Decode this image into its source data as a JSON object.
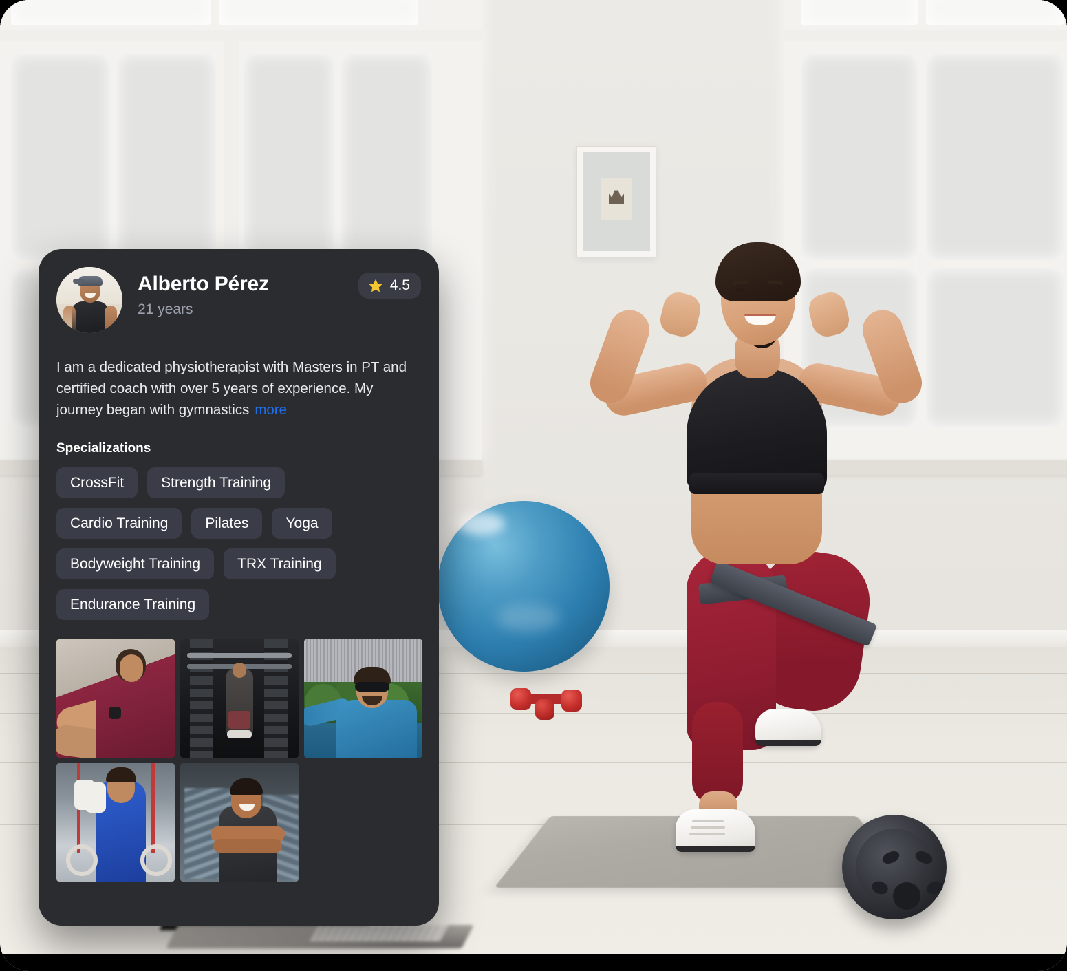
{
  "profile": {
    "name": "Alberto Pérez",
    "age": "21 years",
    "rating": "4.5",
    "rating_icon": "star-icon",
    "avatar_alt": "profile-photo",
    "bio": "I am a dedicated physiotherapist with Masters in PT and certified coach with over 5 years of experience. My journey began with gymnastics",
    "more_label": "more"
  },
  "specializations": {
    "title": "Specializations",
    "tags": [
      "CrossFit",
      "Strength Training",
      "Cardio Training",
      "Pilates",
      "Yoga",
      "Bodyweight Training",
      "TRX Training",
      "Endurance Training"
    ]
  },
  "gallery": {
    "items": [
      "physiotherapy-session-photo",
      "gym-squat-rack-photo",
      "city-viewpoint-selfie-photo",
      "gymnastics-rings-photo",
      "trainer-portrait-gym-photo"
    ]
  },
  "background": {
    "scene": "bright-gym-studio-with-windows",
    "subject": "woman-performing-lunge-with-resistance-band",
    "props": [
      "exercise-ball",
      "red-dumbbells",
      "yoga-mat",
      "ab-roller-wheel",
      "framed-wall-art",
      "laptop"
    ]
  },
  "colors": {
    "card_bg": "#2b2c30",
    "tag_bg": "#3a3d47",
    "badge_bg": "#3a3c45",
    "link_blue": "#1f6feb",
    "star_gold": "#f5c534",
    "muted_text": "#9ca2ad"
  }
}
